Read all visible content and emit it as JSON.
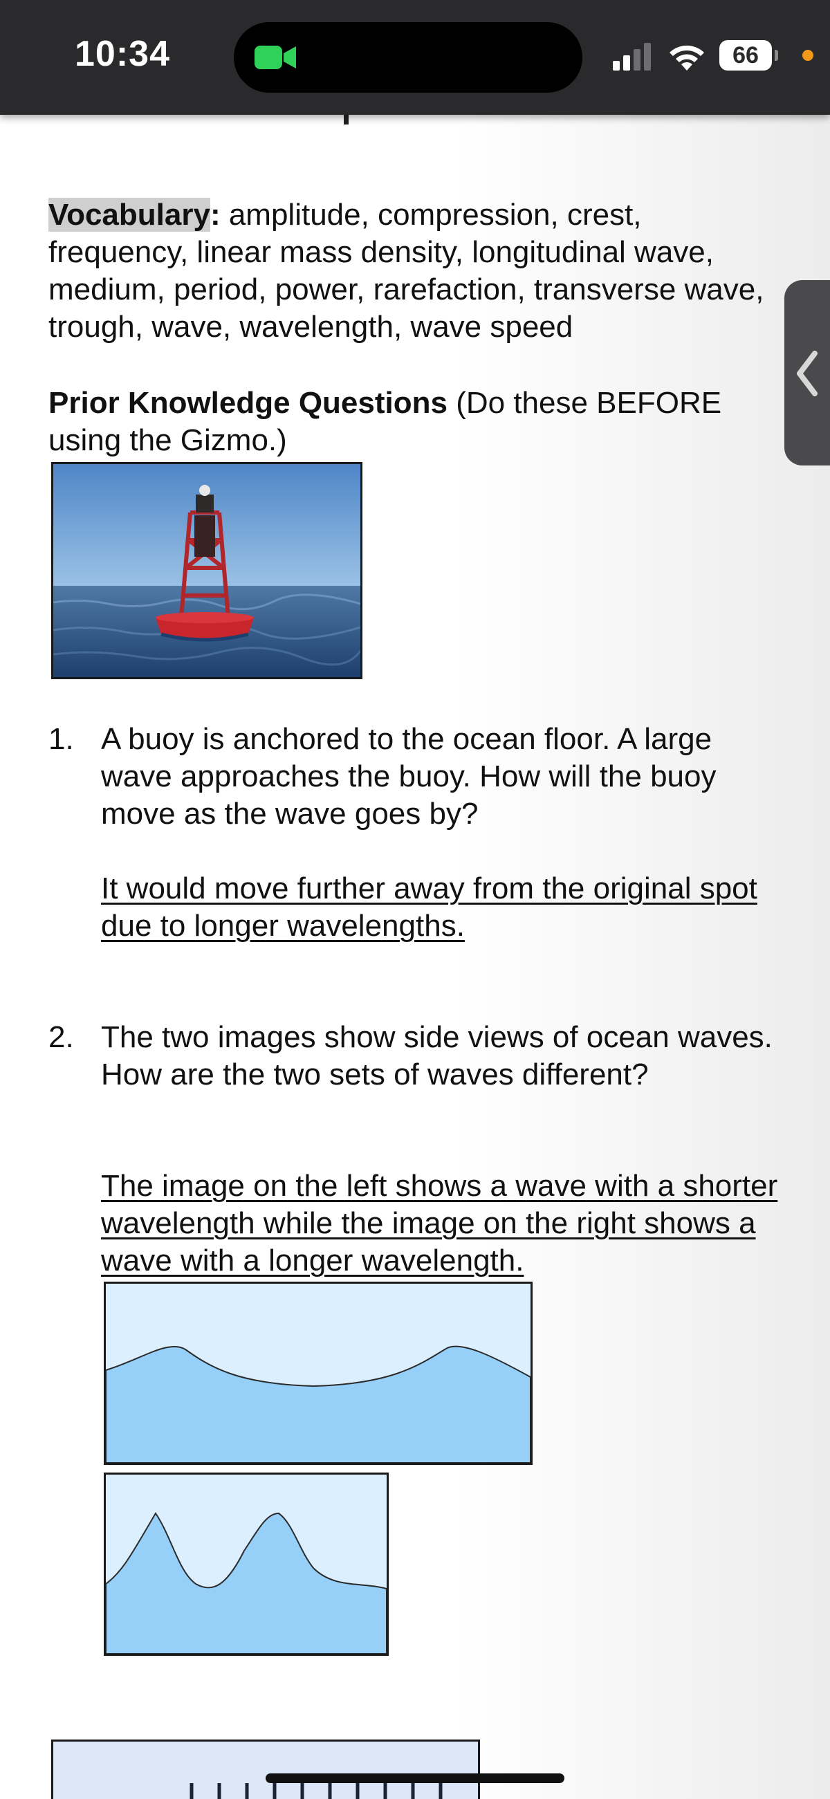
{
  "status_bar": {
    "time": "10:34",
    "battery": "66",
    "colors": {
      "facetime_green": "#30d158",
      "recording_dot": "#f39a1c"
    }
  },
  "document": {
    "vocabulary": {
      "label": "Vocabulary",
      "colon": ":",
      "terms": " amplitude, compression, crest, frequency, linear mass density, longitudinal wave, medium, period, power, rarefaction, transverse wave, trough, wave, wavelength, wave speed"
    },
    "prior_knowledge": {
      "heading": "Prior Knowledge Questions",
      "note": " (Do these BEFORE using the Gizmo.)"
    },
    "questions": [
      {
        "number": "1.",
        "text": "A buoy is anchored to the ocean floor. A large wave approaches the buoy. How will the buoy move as the wave goes by?",
        "answer": "It would move further away from the original spot due to longer wavelengths."
      },
      {
        "number": "2.",
        "text": "The two images show side views of ocean waves. How are the two sets of waves different?",
        "answer": "The image on the left shows a wave with a shorter wavelength while the image on the right shows a wave with a longer wavelength."
      }
    ]
  },
  "icons": {
    "side_tab": "chevron-left-icon",
    "camera": "facetime-icon",
    "signal": "signal-icon",
    "wifi": "wifi-icon"
  }
}
